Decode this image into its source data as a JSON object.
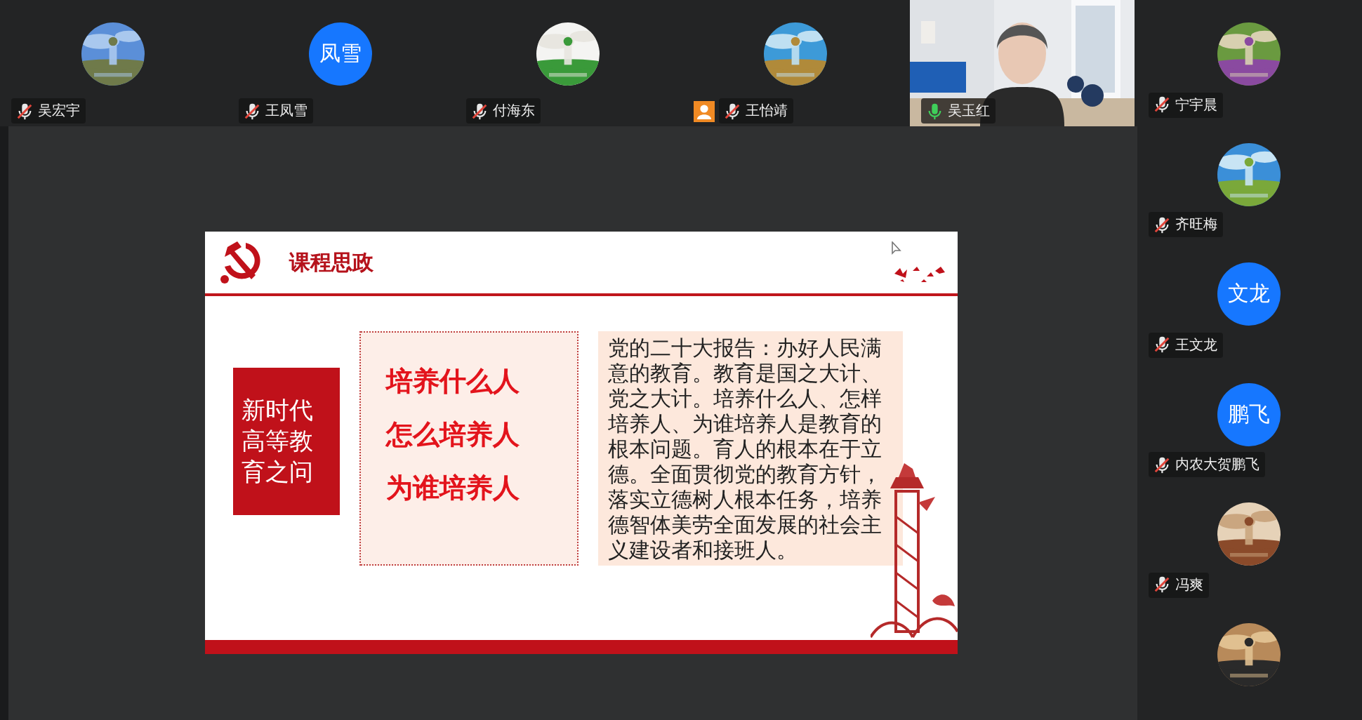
{
  "top_participants": [
    {
      "name": "吴宏宇",
      "kind": "picture",
      "muted": true,
      "badge": false
    },
    {
      "name": "王凤雪",
      "kind": "initials",
      "initials": "凤雪",
      "muted": true,
      "badge": false
    },
    {
      "name": "付海东",
      "kind": "picture",
      "muted": true,
      "badge": false
    },
    {
      "name": "王怡靖",
      "kind": "picture",
      "muted": true,
      "badge": true
    },
    {
      "name": "吴玉红",
      "kind": "video",
      "muted": false,
      "badge": false
    }
  ],
  "side_participants": [
    {
      "name": "宁宇晨",
      "kind": "picture",
      "muted": true
    },
    {
      "name": "齐旺梅",
      "kind": "picture",
      "muted": true
    },
    {
      "name": "王文龙",
      "kind": "initials",
      "initials": "文龙",
      "muted": true
    },
    {
      "name": "内农大贺鹏飞",
      "kind": "initials",
      "initials": "鹏飞",
      "muted": true
    },
    {
      "name": "冯爽",
      "kind": "picture",
      "muted": true
    },
    {
      "kind": "picture"
    }
  ],
  "slide": {
    "title": "课程思政",
    "topic": "新时代高等教育之问",
    "questions": [
      "培养什么人",
      "怎么培养人",
      "为谁培养人"
    ],
    "paragraph": "党的二十大报告：办好人民满意的教育。教育是国之大计、党之大计。培养什么人、怎样培养人、为谁培养人是教育的根本问题。育人的根本在于立德。全面贯彻党的教育方针，落实立德树人根本任务，培养德智体美劳全面发展的社会主义建设者和接班人。"
  }
}
